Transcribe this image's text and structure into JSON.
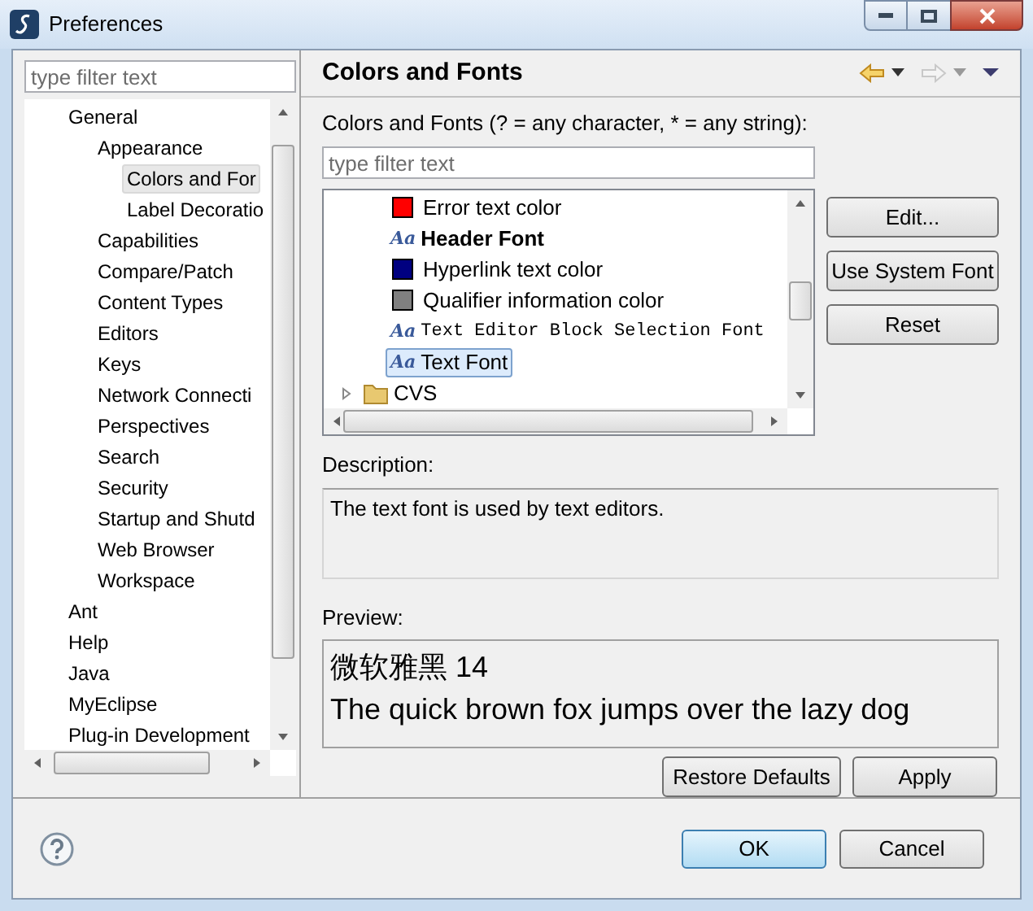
{
  "window": {
    "title": "Preferences"
  },
  "sidebar": {
    "filter": {
      "placeholder": "type filter text"
    },
    "items": [
      {
        "label": "General",
        "children": [
          {
            "label": "Appearance",
            "children": [
              {
                "label": "Colors and For",
                "selected": true
              },
              {
                "label": "Label Decoratio",
                "selected": false
              }
            ],
            "selected": false
          },
          {
            "label": "Capabilities",
            "selected": false
          },
          {
            "label": "Compare/Patch",
            "selected": false
          },
          {
            "label": "Content Types",
            "selected": false
          },
          {
            "label": "Editors",
            "selected": false
          },
          {
            "label": "Keys",
            "selected": false
          },
          {
            "label": "Network Connecti",
            "selected": false
          },
          {
            "label": "Perspectives",
            "selected": false
          },
          {
            "label": "Search",
            "selected": false
          },
          {
            "label": "Security",
            "selected": false
          },
          {
            "label": "Startup and Shutd",
            "selected": false
          },
          {
            "label": "Web Browser",
            "selected": false
          },
          {
            "label": "Workspace",
            "selected": false
          }
        ],
        "selected": false
      },
      {
        "label": "Ant",
        "selected": false
      },
      {
        "label": "Help",
        "selected": false
      },
      {
        "label": "Java",
        "selected": false
      },
      {
        "label": "MyEclipse",
        "selected": false
      },
      {
        "label": "Plug-in Development",
        "selected": false
      }
    ]
  },
  "page": {
    "title": "Colors and Fonts",
    "filter_label": "Colors and Fonts (? = any character, * = any string):",
    "filter": {
      "placeholder": "type filter text"
    },
    "tree": [
      {
        "kind": "color",
        "label": "Error text color",
        "color": "#ff0000",
        "selected": false
      },
      {
        "kind": "font",
        "icon": "Aa",
        "label": "Header Font",
        "bold": true,
        "monospace": false,
        "selected": false
      },
      {
        "kind": "color",
        "label": "Hyperlink text color",
        "color": "#000080",
        "selected": false
      },
      {
        "kind": "color",
        "label": "Qualifier information color",
        "color": "#808080",
        "selected": false
      },
      {
        "kind": "font",
        "icon": "Aa",
        "label": "Text Editor Block Selection Font",
        "bold": false,
        "monospace": true,
        "selected": false
      },
      {
        "kind": "font",
        "icon": "Aa",
        "label": "Text Font",
        "bold": false,
        "monospace": false,
        "selected": true
      },
      {
        "kind": "folder",
        "label": "CVS",
        "expanded": false,
        "selected": false
      }
    ],
    "side_buttons": [
      "Edit...",
      "Use System Font",
      "Reset"
    ],
    "description_label": "Description:",
    "description": "The text font is used by text editors.",
    "preview_label": "Preview:",
    "preview": [
      "微软雅黑 14",
      "The quick brown fox jumps over the lazy dog"
    ],
    "buttons": [
      "Restore Defaults",
      "Apply"
    ]
  },
  "footer_buttons": [
    {
      "label": "OK",
      "default": true
    },
    {
      "label": "Cancel",
      "default": false
    }
  ]
}
